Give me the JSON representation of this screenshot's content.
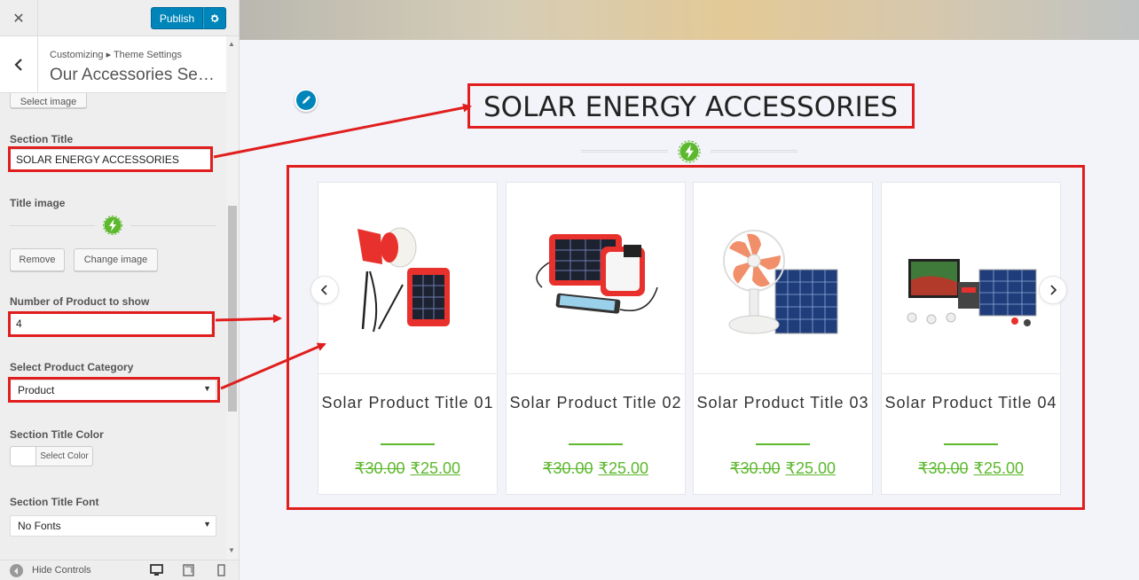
{
  "sidebar": {
    "close_icon": "close-icon",
    "publish_label": "Publish",
    "gear_icon": "gear-icon",
    "breadcrumb": "Customizing ▸ Theme Settings",
    "section_title": "Our Accessories Secti...",
    "select_image_label": "Select image",
    "fields": {
      "section_title_label": "Section Title",
      "section_title_value": "SOLAR ENERGY ACCESSORIES",
      "title_image_label": "Title image",
      "remove_label": "Remove",
      "change_image_label": "Change image",
      "num_products_label": "Number of Product to show",
      "num_products_value": "4",
      "category_label": "Select Product Category",
      "category_value": "Product",
      "title_color_label": "Section Title Color",
      "select_color_label": "Select Color",
      "title_font_label": "Section Title Font",
      "title_font_value": "No Fonts"
    },
    "footer": {
      "hide_controls_label": "Hide Controls"
    }
  },
  "preview": {
    "heading": "SOLAR ENERGY ACCESSORIES",
    "products": [
      {
        "title": "Solar Product Title 01",
        "old_price": "₹30.00",
        "price": "₹25.00"
      },
      {
        "title": "Solar Product Title 02",
        "old_price": "₹30.00",
        "price": "₹25.00"
      },
      {
        "title": "Solar Product Title 03",
        "old_price": "₹30.00",
        "price": "₹25.00"
      },
      {
        "title": "Solar Product Title 04",
        "old_price": "₹30.00",
        "price": "₹25.00"
      }
    ]
  },
  "colors": {
    "accent": "#0085ba",
    "price_green": "#5cb82c",
    "annotation_red": "#e01e1e"
  }
}
